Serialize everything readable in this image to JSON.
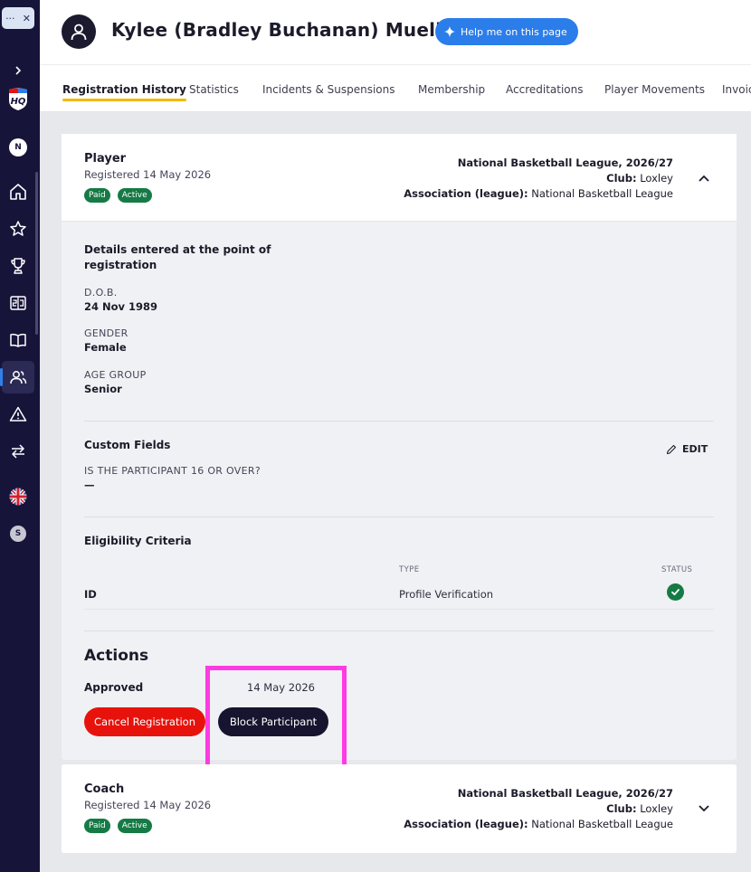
{
  "sidebar": {
    "top_label": "···",
    "top_close": "✕",
    "expand_icon": "chevron-right-icon",
    "logo_text": "HQ",
    "org_initial": "N",
    "user_initial": "S",
    "items": [
      {
        "icon": "home-icon"
      },
      {
        "icon": "star-icon"
      },
      {
        "icon": "trophy-icon"
      },
      {
        "icon": "scoreboard-icon"
      },
      {
        "icon": "book-icon"
      },
      {
        "icon": "people-icon",
        "active": true
      },
      {
        "icon": "warning-icon"
      },
      {
        "icon": "transfer-icon"
      },
      {
        "icon": "uk-flag-icon"
      }
    ]
  },
  "header": {
    "title": "Kylee (Bradley Buchanan) Mueller",
    "help_label": "Help me on this page"
  },
  "tabs": [
    {
      "label": "Registration History",
      "active": true
    },
    {
      "label": "Statistics"
    },
    {
      "label": "Incidents & Suspensions"
    },
    {
      "label": "Membership"
    },
    {
      "label": "Accreditations"
    },
    {
      "label": "Player Movements"
    },
    {
      "label": "Invoic"
    }
  ],
  "player_card": {
    "role": "Player",
    "registered": "Registered 14 May 2026",
    "badges": [
      "Paid",
      "Active"
    ],
    "league_season": "National Basketball League, 2026/27",
    "club_label": "Club:",
    "club_value": "Loxley",
    "assoc_label": "Association (league):",
    "assoc_value": "National Basketball League",
    "details": {
      "title_line1": "Details entered at the point of",
      "title_line2": "registration",
      "fields": [
        {
          "label": "D.O.B.",
          "value": "24 Nov 1989"
        },
        {
          "label": "GENDER",
          "value": "Female"
        },
        {
          "label": "AGE GROUP",
          "value": "Senior"
        }
      ]
    },
    "custom_fields": {
      "title": "Custom Fields",
      "edit_label": "EDIT",
      "question": "IS THE PARTICIPANT 16 OR OVER?",
      "answer": "—"
    },
    "eligibility": {
      "title": "Eligibility Criteria",
      "col_type": "TYPE",
      "col_status": "STATUS",
      "row_name": "ID",
      "row_type": "Profile Verification",
      "row_status": "verified"
    },
    "actions": {
      "title": "Actions",
      "status": "Approved",
      "date": "14 May 2026",
      "cancel_label": "Cancel Registration",
      "block_label": "Block Participant"
    }
  },
  "coach_card": {
    "role": "Coach",
    "registered": "Registered 14 May 2026",
    "badges": [
      "Paid",
      "Active"
    ],
    "league_season": "National Basketball League, 2026/27",
    "club_label": "Club:",
    "club_value": "Loxley",
    "assoc_label": "Association (league):",
    "assoc_value": "National Basketball League"
  },
  "colors": {
    "sidebar_bg": "#17143a",
    "accent_blue": "#2b7de9",
    "tab_underline": "#f5b800",
    "badge_green": "#167a45",
    "cancel_red": "#e8120c",
    "highlight_magenta": "#ff3be3"
  }
}
